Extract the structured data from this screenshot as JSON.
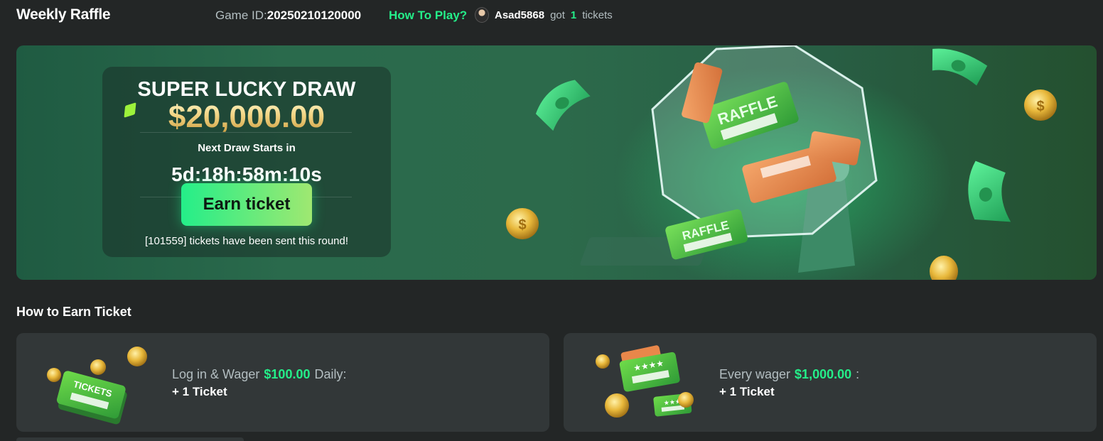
{
  "header": {
    "title": "Weekly Raffle",
    "game_id_label": "Game ID:",
    "game_id_value": "20250210120000",
    "how_to_play": "How To Play?",
    "ticker": {
      "user": "Asad5868",
      "got": "got",
      "count": "1",
      "suffix": "tickets"
    }
  },
  "banner": {
    "draw_title": "SUPER LUCKY DRAW",
    "prize": "$20,000.00",
    "next_draw_label": "Next Draw Starts in",
    "countdown": "5d:18h:58m:10s",
    "earn_button": "Earn ticket",
    "sent_info": "[101559] tickets have been sent this round!",
    "ticket_label": "RAFFLE"
  },
  "earn_section": {
    "title": "How to Earn Ticket",
    "cards": [
      {
        "prefix": "Log in & Wager",
        "amount": "$100.00",
        "suffix": "Daily:",
        "reward": "+ 1 Ticket",
        "illustration_label": "TICKETS"
      },
      {
        "prefix": "Every wager",
        "amount": "$1,000.00",
        "suffix": ":",
        "reward": "+ 1 Ticket"
      }
    ]
  },
  "colors": {
    "accent_green": "#24ee89",
    "background": "#232626",
    "card": "#323738",
    "muted_text": "#b3bec1",
    "gold": "#e8b83b"
  }
}
